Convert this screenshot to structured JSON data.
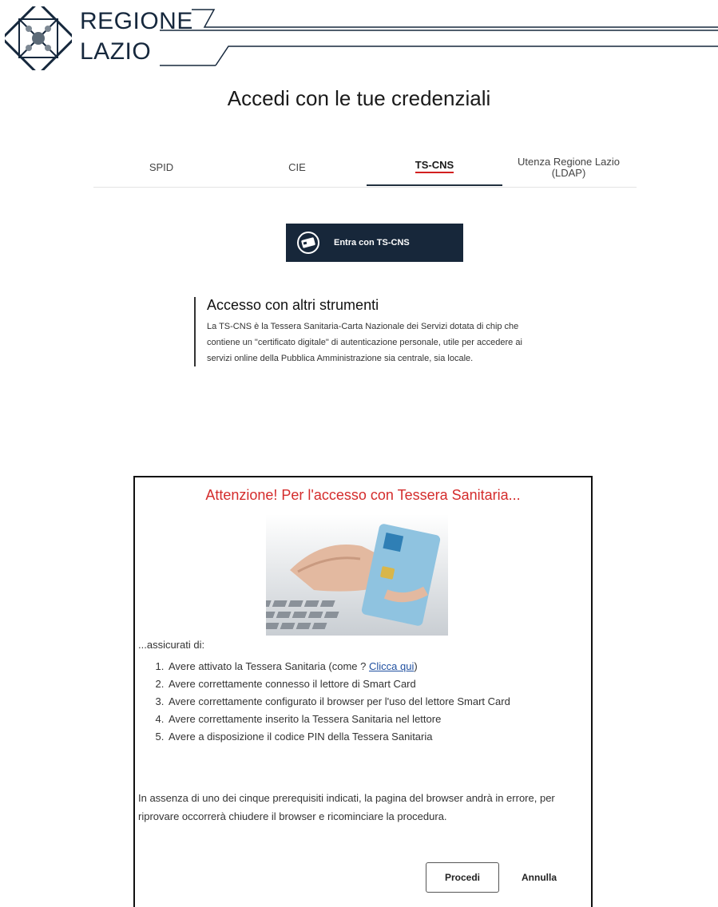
{
  "header": {
    "brand_line1": "REGIONE",
    "brand_line2": "LAZIO",
    "emblem_icon": "regione-lazio-emblem"
  },
  "page_title": "Accedi con le tue credenziali",
  "tabs": [
    {
      "label": "SPID",
      "active": false
    },
    {
      "label": "CIE",
      "active": false
    },
    {
      "label": "TS-CNS",
      "active": true
    },
    {
      "label": "Utenza Regione Lazio (LDAP)",
      "active": false
    }
  ],
  "enter_button": {
    "label": "Entra con TS-CNS",
    "icon": "card-icon"
  },
  "info": {
    "heading": "Accesso con altri strumenti",
    "body": "La TS-CNS è la Tessera Sanitaria-Carta Nazionale dei Servizi dotata di chip che contiene un \"certificato digitale\" di autenticazione personale, utile per accedere ai servizi online della Pubblica Amministrazione sia centrale, sia locale."
  },
  "modal": {
    "title": "Attenzione! Per l'accesso con Tessera Sanitaria...",
    "intro": "...assicurati di:",
    "item1_text": "Avere attivato la Tessera Sanitaria (come ? ",
    "item1_link": "Clicca qui",
    "item1_tail": ")",
    "item2": "Avere correttamente connesso il lettore di Smart Card",
    "item3": "Avere correttamente configurato il browser per l'uso del lettore Smart Card",
    "item4": "Avere correttamente inserito la Tessera Sanitaria nel lettore",
    "item5": "Avere a disposizione il codice PIN della Tessera Sanitaria",
    "note": "In assenza di uno dei cinque prerequisiti indicati, la pagina del browser andrà in errore, per riprovare occorrerà chiudere il browser e ricominciare la procedura.",
    "proceed_label": "Procedi",
    "cancel_label": "Annulla"
  },
  "colors": {
    "navy": "#17273a",
    "alert_red": "#d42c2c",
    "tab_accent": "#d21f1f",
    "link": "#2050a0"
  }
}
